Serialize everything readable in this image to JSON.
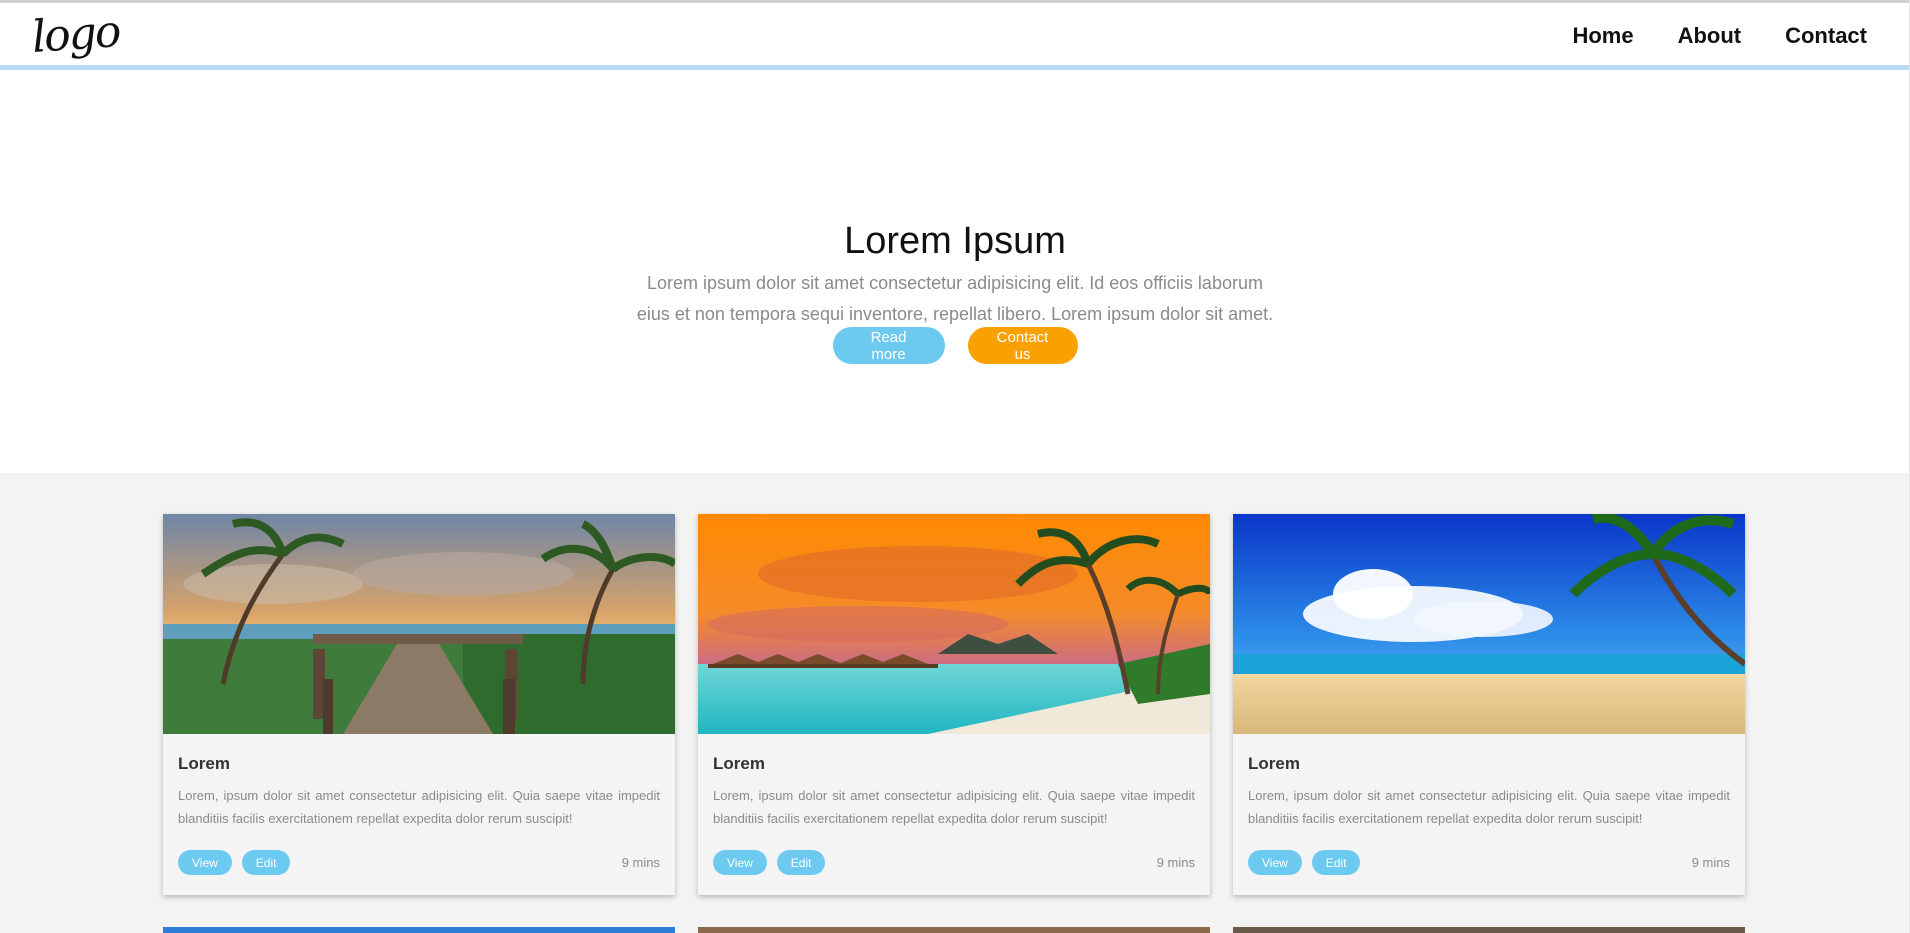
{
  "header": {
    "logo": "logo",
    "nav": [
      "Home",
      "About",
      "Contact"
    ]
  },
  "hero": {
    "title": "Lorem Ipsum",
    "text": "Lorem ipsum dolor sit amet consectetur adipisicing elit. Id eos officiis laborum eius et non tempora sequi inventore, repellat libero. Lorem ipsum dolor sit amet.",
    "buttons": {
      "read_more": "Read more",
      "contact": "Contact us"
    }
  },
  "cards": [
    {
      "title": "Lorem",
      "text": "Lorem, ipsum dolor sit amet consectetur adipisicing elit. Quia saepe vitae impedit blanditiis facilis exercitationem repellat expedita dolor rerum suscipit!",
      "view": "View",
      "edit": "Edit",
      "time": "9 mins"
    },
    {
      "title": "Lorem",
      "text": "Lorem, ipsum dolor sit amet consectetur adipisicing elit. Quia saepe vitae impedit blanditiis facilis exercitationem repellat expedita dolor rerum suscipit!",
      "view": "View",
      "edit": "Edit",
      "time": "9 mins"
    },
    {
      "title": "Lorem",
      "text": "Lorem, ipsum dolor sit amet consectetur adipisicing elit. Quia saepe vitae impedit blanditiis facilis exercitationem repellat expedita dolor rerum suscipit!",
      "view": "View",
      "edit": "Edit",
      "time": "9 mins"
    }
  ],
  "colors": {
    "primary": "#6ccaf1",
    "accent": "#f8a100",
    "text": "#8a8a8a",
    "background": "#f3f3f3"
  }
}
